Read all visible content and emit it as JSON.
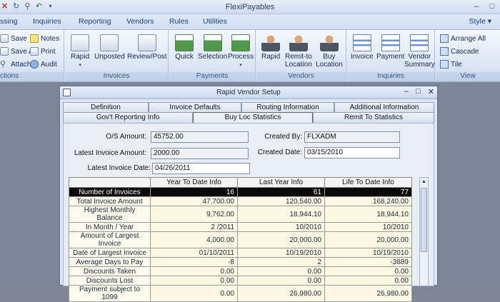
{
  "app": {
    "title": "FlexiPayables"
  },
  "quick_access": {
    "icons": [
      "close-icon",
      "refresh-icon",
      "attach-icon",
      "undo-icon",
      "dropdown-icon"
    ]
  },
  "menu": {
    "items": [
      "ssing",
      "Inquiries",
      "Reporting",
      "Vendors",
      "Rules",
      "Utilities"
    ],
    "style_label": "Style"
  },
  "ribbon": {
    "actions": {
      "save": "Save",
      "notes": "Notes",
      "save_as": "Save As",
      "print": "Print",
      "attach": "Attach",
      "audit": "Audit",
      "group_label": "ctions"
    },
    "invoices": {
      "rapid": "Rapid",
      "unposted": "Unposted",
      "review_post": "Review/Post",
      "group_label": "Invoices"
    },
    "payments": {
      "quick": "Quick",
      "selection": "Selection",
      "process": "Process",
      "group_label": "Payments"
    },
    "vendors": {
      "rapid": "Rapid",
      "remit_to_1": "Remit-to",
      "remit_to_2": "Location",
      "buy_1": "Buy",
      "buy_2": "Location",
      "group_label": "Vendors"
    },
    "inquiries": {
      "invoice": "Invoice",
      "payment": "Payment",
      "vendor_1": "Vendor",
      "vendor_2": "Summary",
      "group_label": "Inquiries"
    },
    "view": {
      "arrange_all": "Arrange All",
      "cascade": "Cascade",
      "tile": "Tile",
      "group_label": "View"
    }
  },
  "dialog": {
    "title": "Rapid Vendor Setup",
    "tabs_row1": [
      "Definition",
      "Invoice Defaults",
      "Routing Information",
      "Additional Information"
    ],
    "tabs_row2": [
      "Gov't Reporting Info",
      "Buy Loc Statistics",
      "Remit To Statistics"
    ],
    "active_tab": "Buy Loc Statistics",
    "fields": {
      "os_amount_label": "O/S Amount:",
      "os_amount": "45752.00",
      "latest_invoice_amount_label": "Latest Invoice Amount:",
      "latest_invoice_amount": "2000.00",
      "latest_invoice_date_label": "Latest Invoice Date:",
      "latest_invoice_date": "04/26/2011",
      "created_by_label": "Created By:",
      "created_by": "FLXADM",
      "created_date_label": "Created Date:",
      "created_date": "03/15/2010"
    },
    "grid": {
      "headers": [
        "",
        "Year To Date Info",
        "Last Year Info",
        "Life To Date Info"
      ],
      "rows": [
        [
          "Number of Invoices",
          "16",
          "61",
          "77"
        ],
        [
          "Total Invoice Amount",
          "47,700.00",
          "120,540.00",
          "168,240.00"
        ],
        [
          "Highest Monthly Balance",
          "9,762.00",
          "18,944.10",
          "18,944.10"
        ],
        [
          "In Month / Year",
          "2 /2011",
          "10/2010",
          "10/2010"
        ],
        [
          "Amount of Largest Invoice",
          "4,000.00",
          "20,000.00",
          "20,000.00"
        ],
        [
          "Date of Largest Invoice",
          "01/10/2011",
          "10/19/2010",
          "10/19/2010"
        ],
        [
          "Average Days to Pay",
          "-8",
          "2",
          "-3889"
        ],
        [
          "Discounts Taken",
          "0.00",
          "0.00",
          "0.00"
        ],
        [
          "Discounts Lost",
          "0.00",
          "0.00",
          "0.00"
        ],
        [
          "Payment subject to 1099",
          "0.00",
          "26,980.00",
          "26,980.00"
        ]
      ]
    }
  }
}
